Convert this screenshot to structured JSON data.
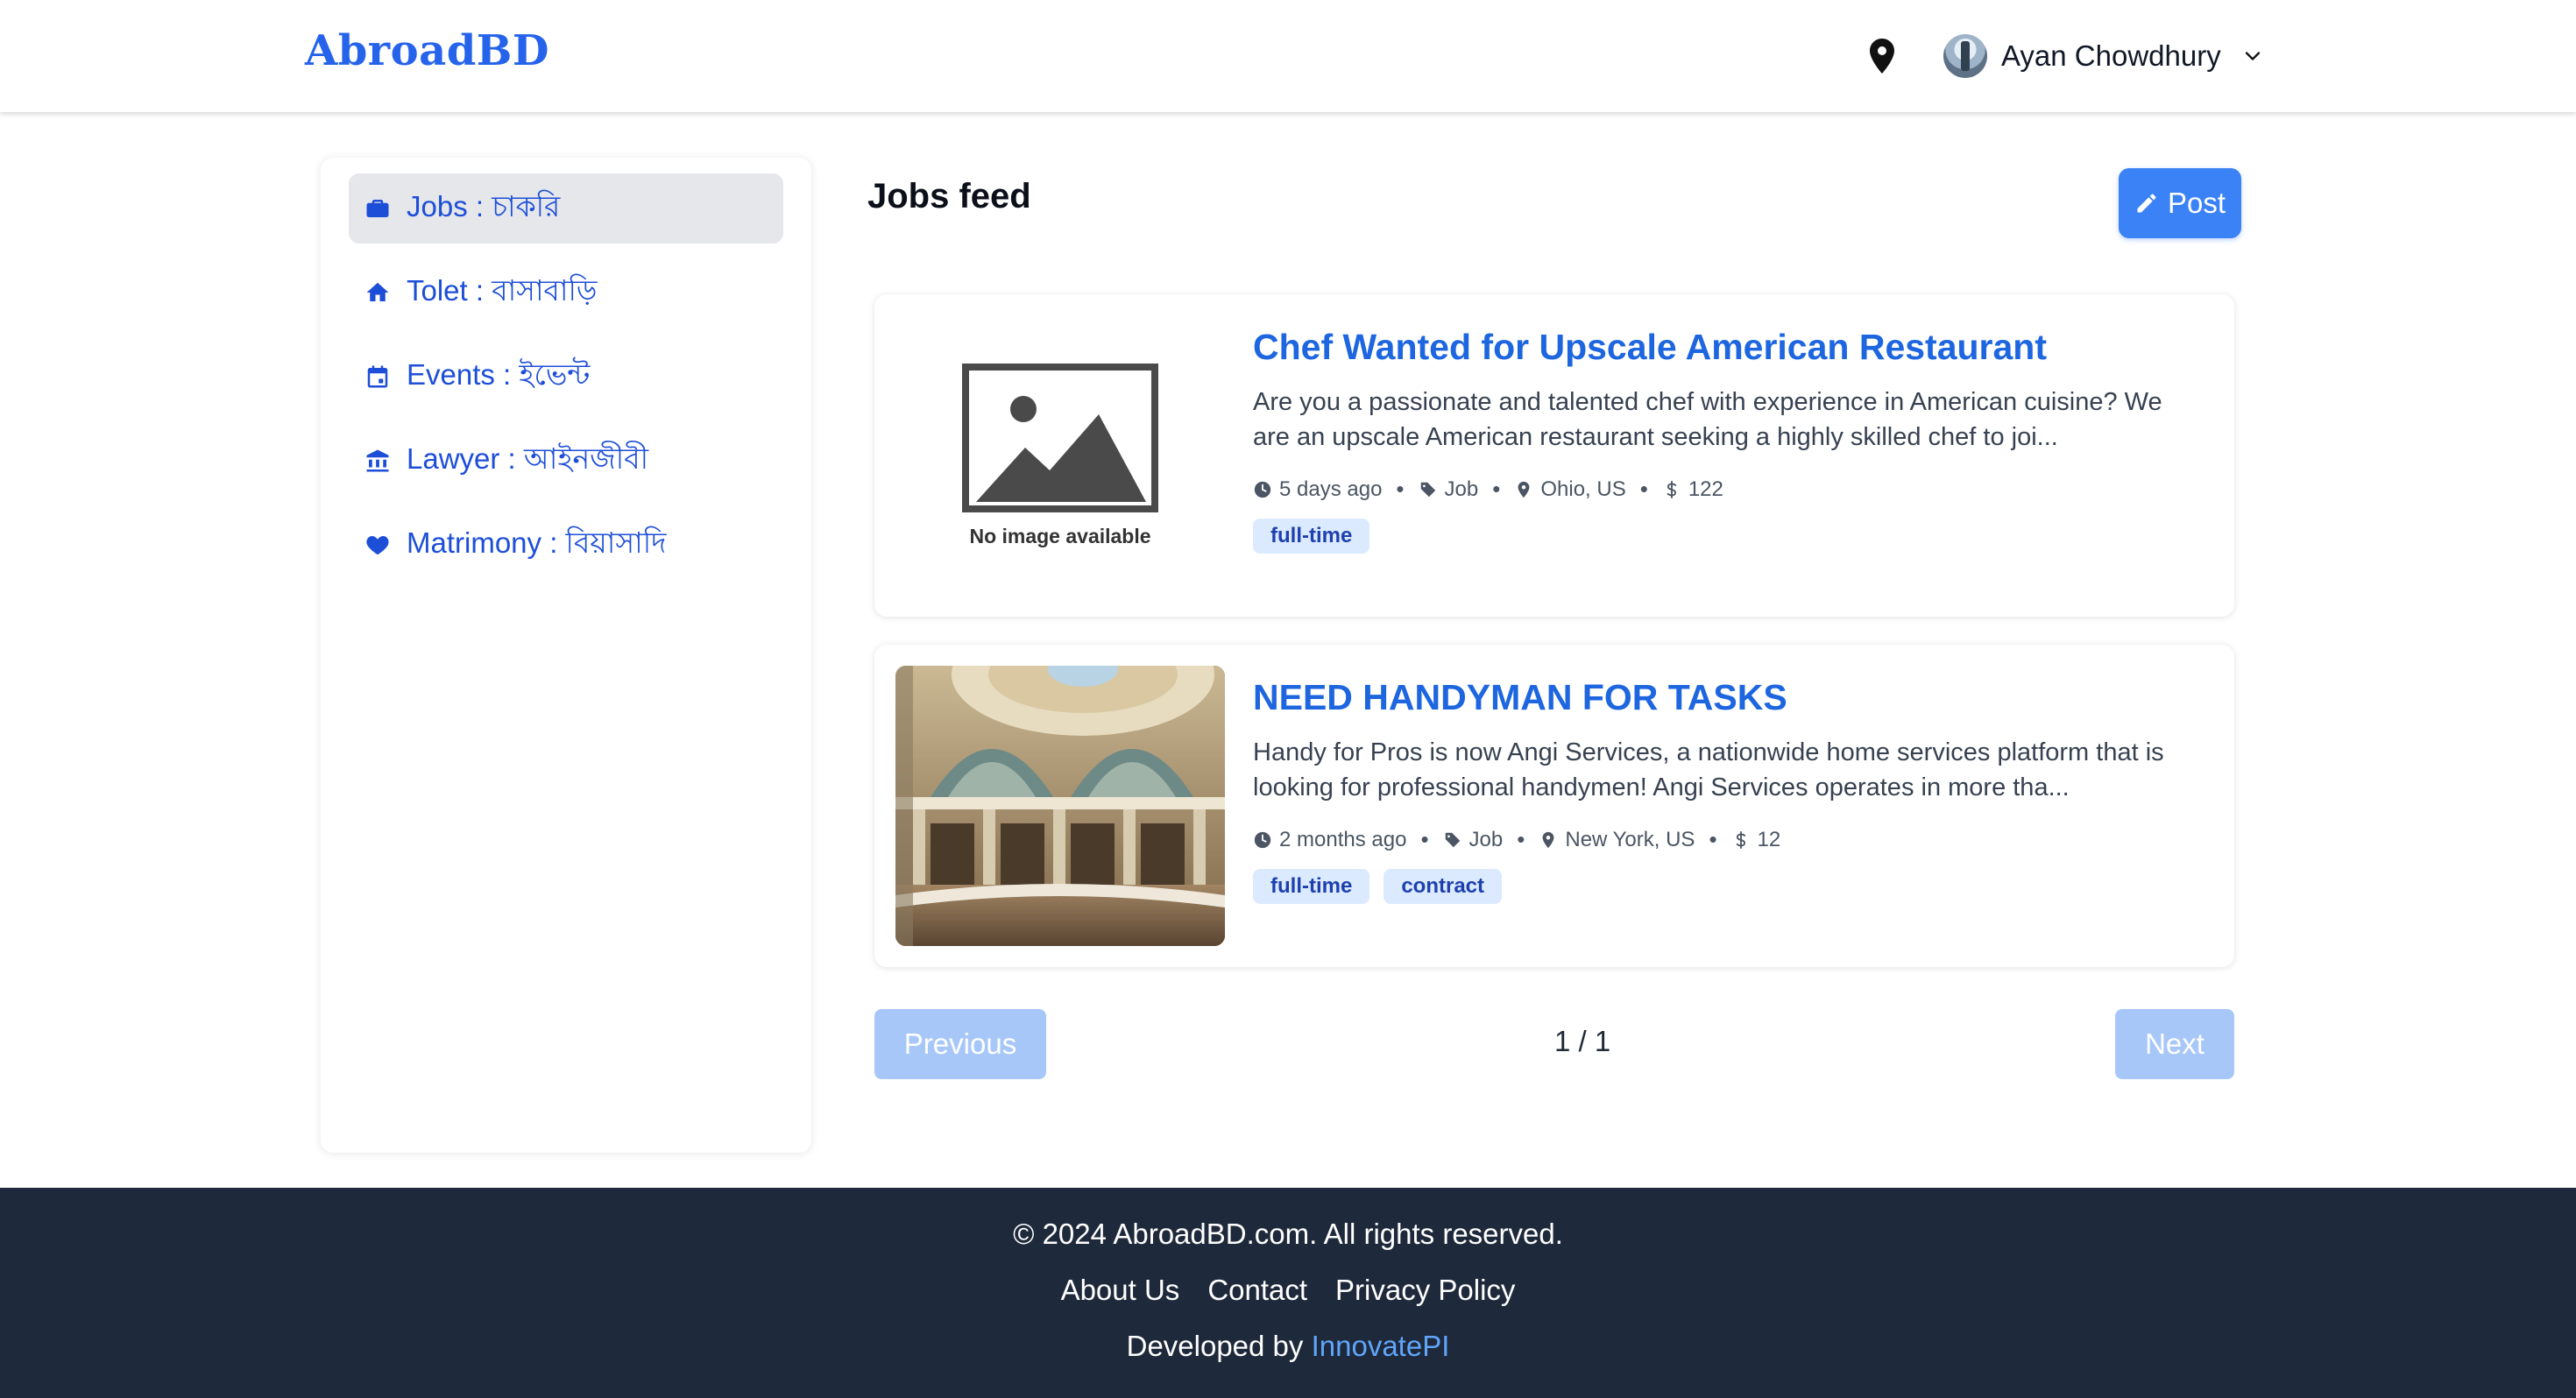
{
  "header": {
    "logo": "AbroadBD",
    "user_name": "Ayan Chowdhury",
    "icons": {
      "location": "map-pin-icon",
      "dropdown": "chevron-down-icon",
      "avatar": "user-avatar"
    }
  },
  "sidebar": {
    "items": [
      {
        "label": "Jobs : চাকরি",
        "icon": "briefcase-icon",
        "active": true
      },
      {
        "label": "Tolet : বাসাবাড়ি",
        "icon": "home-icon",
        "active": false
      },
      {
        "label": "Events : ইভেন্ট",
        "icon": "calendar-icon",
        "active": false
      },
      {
        "label": "Lawyer : আইনজীবী",
        "icon": "bank-icon",
        "active": false
      },
      {
        "label": "Matrimony : বিয়াসাদি",
        "icon": "heart-icon",
        "active": false
      }
    ]
  },
  "main": {
    "title": "Jobs feed",
    "post_button": "Post",
    "posts": [
      {
        "title": "Chef Wanted for Upscale American Restaurant",
        "description": "Are you a passionate and talented chef with experience in American cuisine? We are an upscale American restaurant seeking a highly skilled chef to joi...",
        "image_placeholder": "No image available",
        "time": "5 days ago",
        "category": "Job",
        "location": "Ohio, US",
        "price": "122",
        "tags": [
          "full-time"
        ]
      },
      {
        "title": "NEED HANDYMAN FOR TASKS",
        "description": "Handy for Pros is now Angi Services, a nationwide home services platform that is looking for professional handymen! Angi Services operates in more tha...",
        "time": "2 months ago",
        "category": "Job",
        "location": "New York, US",
        "price": "12",
        "tags": [
          "full-time",
          "contract"
        ]
      }
    ],
    "pagination": {
      "previous": "Previous",
      "info": "1 / 1",
      "next": "Next"
    }
  },
  "footer": {
    "copyright": "© 2024 AbroadBD.com. All rights reserved.",
    "links": [
      "About Us",
      "Contact",
      "Privacy Policy"
    ],
    "developed_by": "Developed by",
    "developer": "InnovatePI"
  },
  "colors": {
    "brand": "#2563eb",
    "post_button": "#3b82f6",
    "tag_bg": "#dbeafe",
    "footer_bg": "#1e293b",
    "pagination_disabled": "#a7c7f9"
  }
}
